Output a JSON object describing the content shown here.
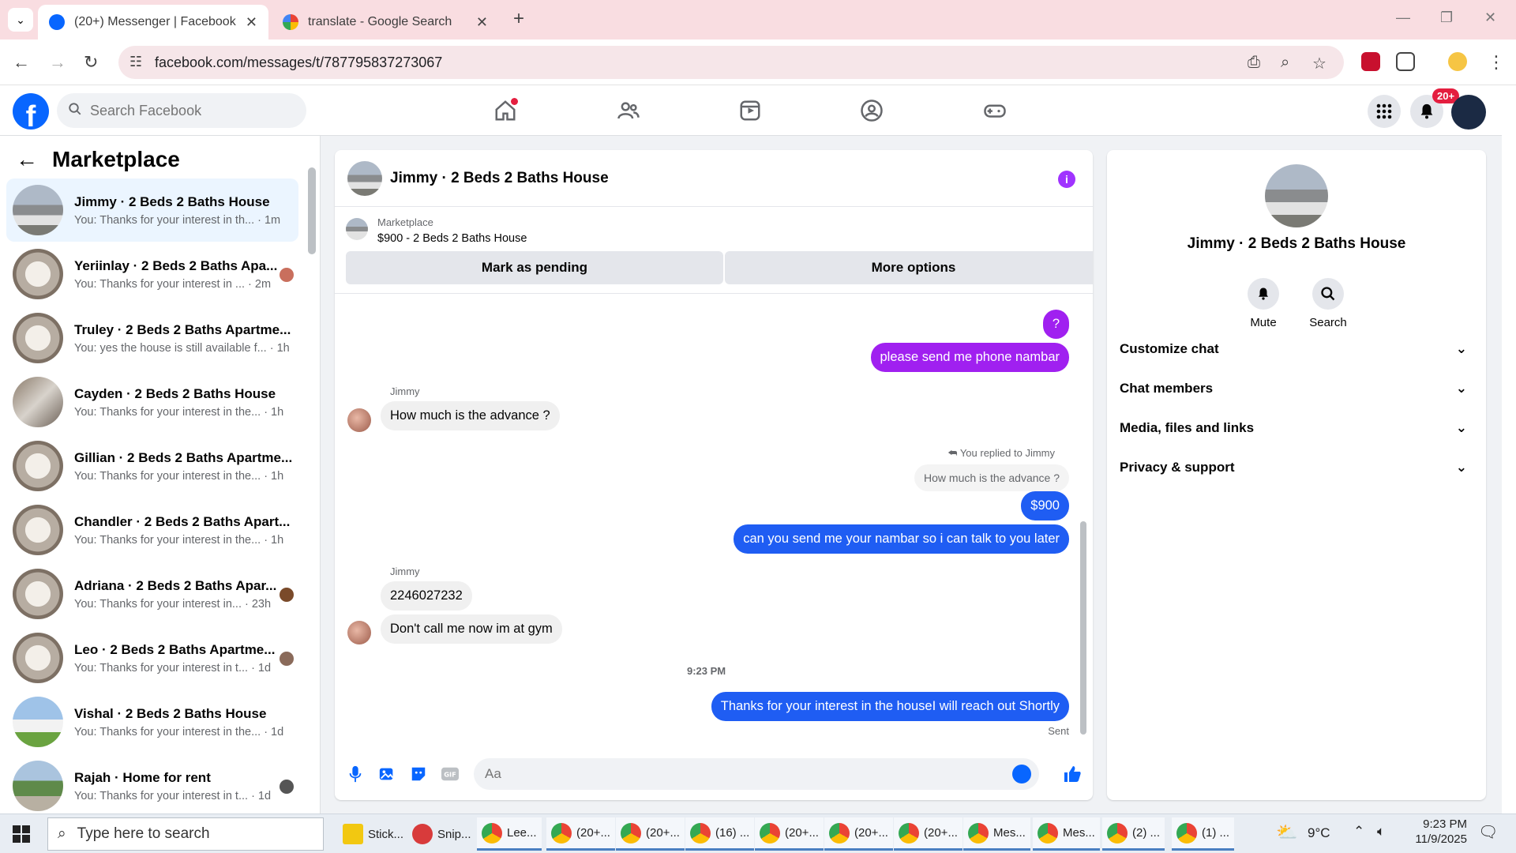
{
  "browser": {
    "tabs": [
      {
        "title": "(20+) Messenger | Facebook",
        "active": true
      },
      {
        "title": "translate - Google Search",
        "active": false
      }
    ],
    "url": "facebook.com/messages/t/787795837273067"
  },
  "fb": {
    "search_placeholder": "Search Facebook",
    "notif_badge": "20+",
    "colors": {
      "brand": "#0866ff",
      "accent_purple": "#a020f0",
      "accent_blue": "#1f5df3"
    }
  },
  "sidebar": {
    "title": "Marketplace",
    "conversations": [
      {
        "name": "Jimmy · 2 Beds 2 Baths House",
        "preview": "You: Thanks for your interest in th... · 1m"
      },
      {
        "name": "Yeriinlay · 2 Beds 2 Baths Apa...",
        "preview": "You: Thanks for your interest in ... · 2m"
      },
      {
        "name": "Truley · 2 Beds 2 Baths Apartme...",
        "preview": "You: yes the house is still available f... · 1h"
      },
      {
        "name": "Cayden · 2 Beds 2 Baths House",
        "preview": "You: Thanks for your interest in the... · 1h"
      },
      {
        "name": "Gillian · 2 Beds 2 Baths Apartme...",
        "preview": "You: Thanks for your interest in the... · 1h"
      },
      {
        "name": "Chandler · 2 Beds 2 Baths Apart...",
        "preview": "You: Thanks for your interest in the... · 1h"
      },
      {
        "name": "Adriana · 2 Beds 2 Baths Apar...",
        "preview": "You: Thanks for your interest in... · 23h"
      },
      {
        "name": "Leo · 2 Beds 2 Baths Apartme...",
        "preview": "You: Thanks for your interest in t... · 1d"
      },
      {
        "name": "Vishal · 2 Beds 2 Baths House",
        "preview": "You: Thanks for your interest in the... · 1d"
      },
      {
        "name": "Rajah · Home for rent",
        "preview": "You: Thanks for your interest in t... · 1d"
      }
    ]
  },
  "chat": {
    "title": "Jimmy · 2 Beds 2 Baths House",
    "marketplace_label": "Marketplace",
    "listing": "$900 - 2 Beds 2 Baths House",
    "mark_pending": "Mark as pending",
    "more_options": "More options",
    "messages": {
      "m1": "?",
      "m2": "please send me phone nambar",
      "sender1": "Jimmy",
      "m3": "How much is the advance ?",
      "reply_note": "You replied to Jimmy",
      "quoted": "How much is the advance ?",
      "m4": "$900",
      "m5": "can you send me your nambar so i can talk to you later",
      "sender2": "Jimmy",
      "m6": "2246027232",
      "m7": "Don't call me now im at gym",
      "timestamp": "9:23 PM",
      "m8": "Thanks for your interest in the houseI will reach out Shortly",
      "status": "Sent"
    },
    "composer_placeholder": "Aa"
  },
  "details": {
    "name": "Jimmy · 2 Beds 2 Baths House",
    "mute": "Mute",
    "search": "Search",
    "sections": [
      "Customize chat",
      "Chat members",
      "Media, files and links",
      "Privacy & support"
    ]
  },
  "taskbar": {
    "search_placeholder": "Type here to search",
    "apps": [
      "Stick...",
      "Snip...",
      "Lee...",
      "(20+...",
      "(20+...",
      "(16) ...",
      "(20+...",
      "(20+...",
      "(20+...",
      "Mes...",
      "Mes...",
      "(2) ...",
      "(1) ..."
    ],
    "weather": "9°C",
    "time": "9:23 PM",
    "date": "11/9/2025"
  }
}
